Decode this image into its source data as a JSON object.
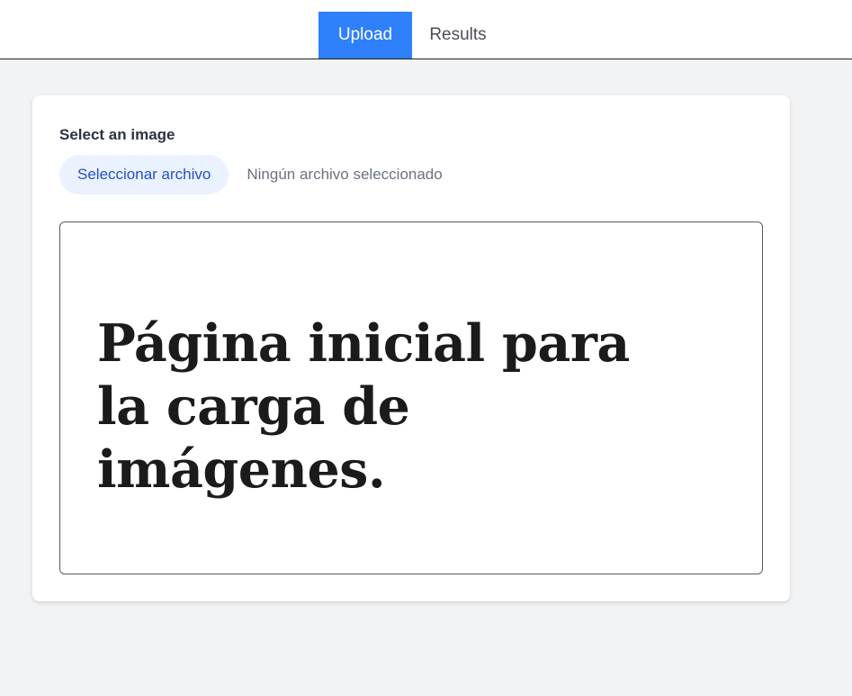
{
  "nav": {
    "tabs": [
      {
        "label": "Upload",
        "active": true
      },
      {
        "label": "Results",
        "active": false
      }
    ]
  },
  "upload": {
    "field_label": "Select an image",
    "choose_button_label": "Seleccionar archivo",
    "file_status": "Ningún archivo seleccionado",
    "preview_text": "Página inicial para la carga de imágenes."
  },
  "colors": {
    "accent": "#2f80fb",
    "page_background": "#f2f3f5",
    "file_button_background": "#eaf2ff",
    "file_button_text": "#2350c8"
  }
}
